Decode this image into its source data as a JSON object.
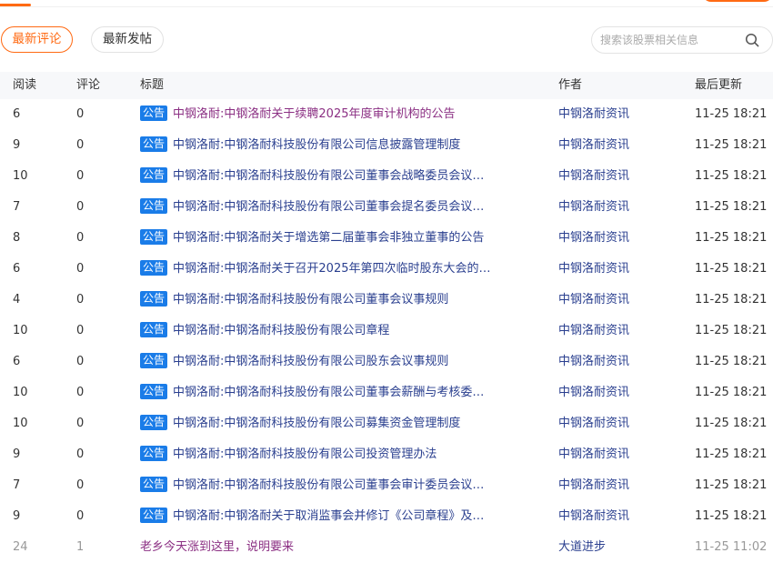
{
  "tabs": {
    "latest_comment": "最新评论",
    "latest_post": "最新发帖"
  },
  "search": {
    "placeholder": "搜索该股票相关信息",
    "icon": "search-icon"
  },
  "colors": {
    "accent": "#ff6a13",
    "badge": "#1a7ce8",
    "link": "#2a3f8f",
    "visited_link": "#8b2f83"
  },
  "table": {
    "headers": [
      "阅读",
      "评论",
      "标题",
      "作者",
      "最后更新"
    ],
    "rows": [
      {
        "read": "6",
        "comments": "0",
        "badge": "公告",
        "title": "中钢洛耐:中钢洛耐关于续聘2025年度审计机构的公告",
        "author": "中钢洛耐资讯",
        "updated": "11-25 18:21"
      },
      {
        "read": "9",
        "comments": "0",
        "badge": "公告",
        "title": "中钢洛耐:中钢洛耐科技股份有限公司信息披露管理制度",
        "author": "中钢洛耐资讯",
        "updated": "11-25 18:21"
      },
      {
        "read": "10",
        "comments": "0",
        "badge": "公告",
        "title": "中钢洛耐:中钢洛耐科技股份有限公司董事会战略委员会议…",
        "author": "中钢洛耐资讯",
        "updated": "11-25 18:21"
      },
      {
        "read": "7",
        "comments": "0",
        "badge": "公告",
        "title": "中钢洛耐:中钢洛耐科技股份有限公司董事会提名委员会议…",
        "author": "中钢洛耐资讯",
        "updated": "11-25 18:21"
      },
      {
        "read": "8",
        "comments": "0",
        "badge": "公告",
        "title": "中钢洛耐:中钢洛耐关于增选第二届董事会非独立董事的公告",
        "author": "中钢洛耐资讯",
        "updated": "11-25 18:21"
      },
      {
        "read": "6",
        "comments": "0",
        "badge": "公告",
        "title": "中钢洛耐:中钢洛耐关于召开2025年第四次临时股东大会的…",
        "author": "中钢洛耐资讯",
        "updated": "11-25 18:21"
      },
      {
        "read": "4",
        "comments": "0",
        "badge": "公告",
        "title": "中钢洛耐:中钢洛耐科技股份有限公司董事会议事规则",
        "author": "中钢洛耐资讯",
        "updated": "11-25 18:21"
      },
      {
        "read": "10",
        "comments": "0",
        "badge": "公告",
        "title": "中钢洛耐:中钢洛耐科技股份有限公司章程",
        "author": "中钢洛耐资讯",
        "updated": "11-25 18:21"
      },
      {
        "read": "6",
        "comments": "0",
        "badge": "公告",
        "title": "中钢洛耐:中钢洛耐科技股份有限公司股东会议事规则",
        "author": "中钢洛耐资讯",
        "updated": "11-25 18:21"
      },
      {
        "read": "10",
        "comments": "0",
        "badge": "公告",
        "title": "中钢洛耐:中钢洛耐科技股份有限公司董事会薪酬与考核委…",
        "author": "中钢洛耐资讯",
        "updated": "11-25 18:21"
      },
      {
        "read": "10",
        "comments": "0",
        "badge": "公告",
        "title": "中钢洛耐:中钢洛耐科技股份有限公司募集资金管理制度",
        "author": "中钢洛耐资讯",
        "updated": "11-25 18:21"
      },
      {
        "read": "9",
        "comments": "0",
        "badge": "公告",
        "title": "中钢洛耐:中钢洛耐科技股份有限公司投资管理办法",
        "author": "中钢洛耐资讯",
        "updated": "11-25 18:21"
      },
      {
        "read": "7",
        "comments": "0",
        "badge": "公告",
        "title": "中钢洛耐:中钢洛耐科技股份有限公司董事会审计委员会议…",
        "author": "中钢洛耐资讯",
        "updated": "11-25 18:21"
      },
      {
        "read": "9",
        "comments": "0",
        "badge": "公告",
        "title": "中钢洛耐:中钢洛耐关于取消监事会并修订《公司章程》及…",
        "author": "中钢洛耐资讯",
        "updated": "11-25 18:21"
      }
    ],
    "partial_row": {
      "read": "24",
      "comments": "1",
      "title": "老乡今天涨到这里，说明要来",
      "author": "大道进步",
      "updated": "11-25 11:02"
    }
  }
}
